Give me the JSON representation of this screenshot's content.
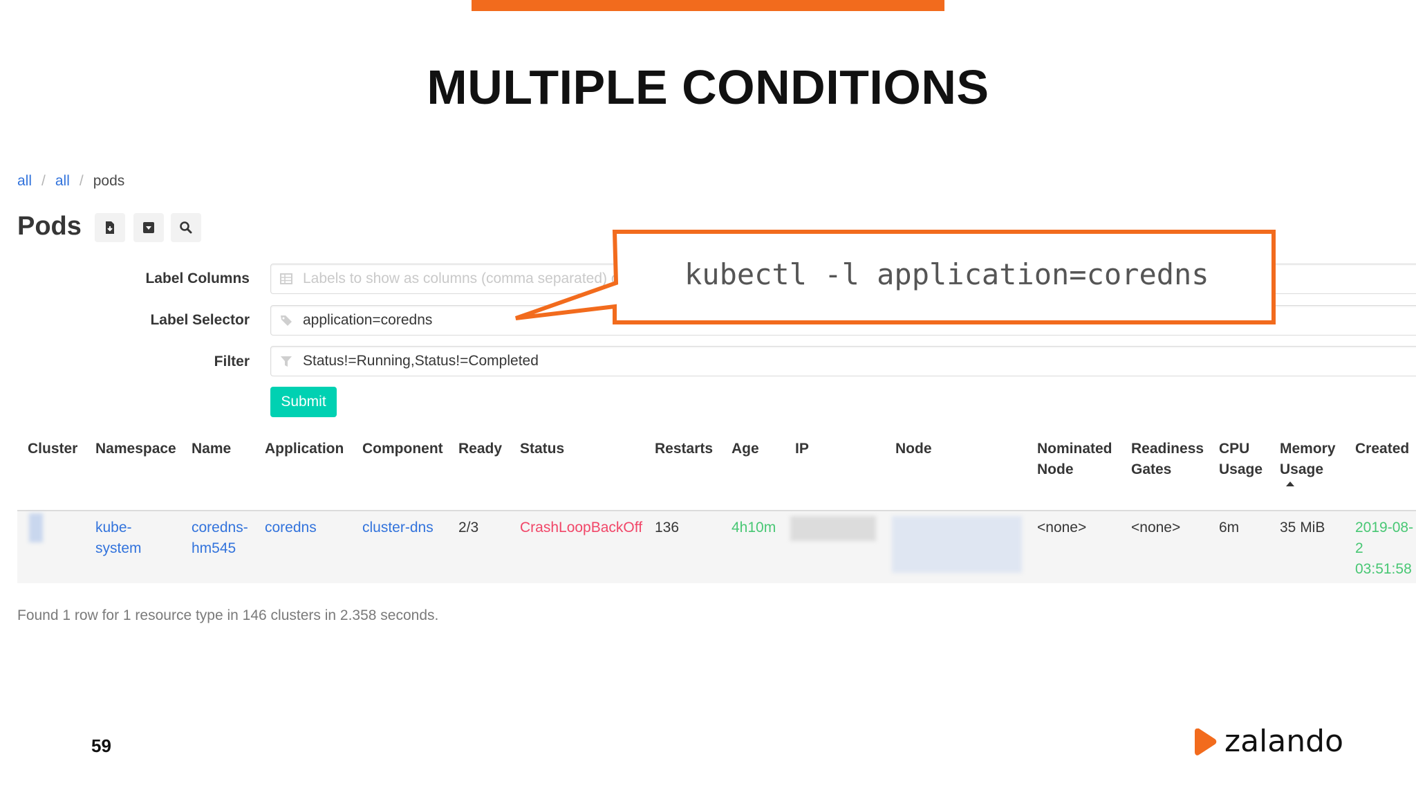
{
  "slide": {
    "title": "MULTIPLE CONDITIONS",
    "number": "59",
    "brand": "zalando"
  },
  "breadcrumb": [
    "all",
    "all",
    "pods"
  ],
  "page": {
    "title": "Pods"
  },
  "form": {
    "label_columns": {
      "label": "Label Columns",
      "placeholder": "Labels to show as columns (comma separated) or *"
    },
    "label_selector": {
      "label": "Label Selector",
      "value": "application=coredns"
    },
    "filter": {
      "label": "Filter",
      "value": "Status!=Running,Status!=Completed"
    },
    "submit_label": "Submit"
  },
  "table": {
    "headers": {
      "cluster": "Cluster",
      "namespace": "Namespace",
      "name": "Name",
      "application": "Application",
      "component": "Component",
      "ready": "Ready",
      "status": "Status",
      "restarts": "Restarts",
      "age": "Age",
      "ip": "IP",
      "node": "Node",
      "nominated_1": "Nominated",
      "nominated_2": "Node",
      "readiness_1": "Readiness",
      "readiness_2": "Gates",
      "cpu_1": "CPU",
      "cpu_2": "Usage",
      "memory_1": "Memory",
      "memory_2": "Usage",
      "created": "Created"
    },
    "row": {
      "namespace_1": "kube-",
      "namespace_2": "system",
      "name_1": "coredns-",
      "name_2": "hm545",
      "application": "coredns",
      "component": "cluster-dns",
      "ready": "2/3",
      "status": "CrashLoopBackOff",
      "restarts": "136",
      "age": "4h10m",
      "nominated_node": "<none>",
      "readiness_gates": "<none>",
      "cpu_usage": "6m",
      "memory_usage": "35 MiB",
      "created_1": "2019-08-2",
      "created_2": "03:51:58"
    }
  },
  "results_summary": "Found 1 row for 1 resource type in 146 clusters in 2.358 seconds.",
  "callout": {
    "text": "kubectl -l application=coredns"
  },
  "colors": {
    "accent": "#f26b1d",
    "link": "#3273dc",
    "danger": "#f14668",
    "success": "#48c774",
    "primary": "#00d1b2"
  }
}
